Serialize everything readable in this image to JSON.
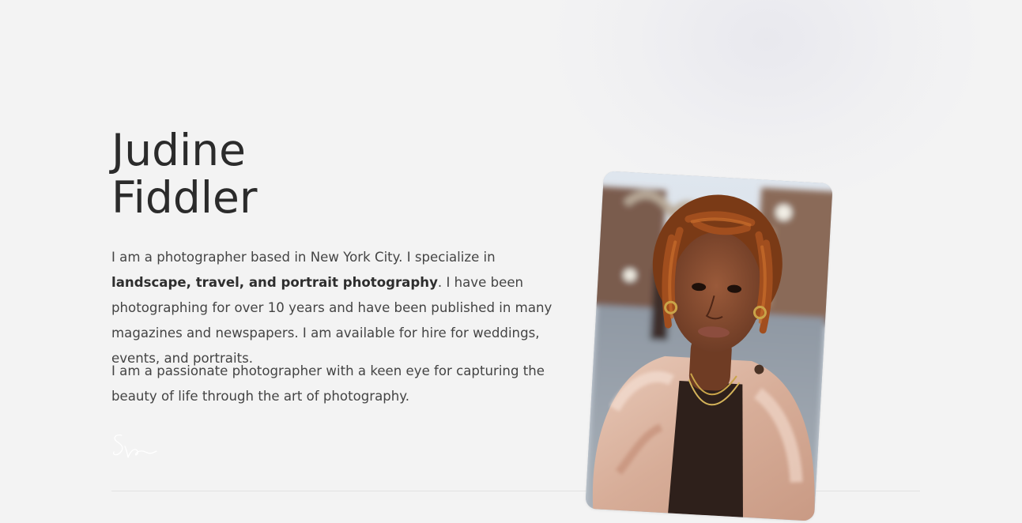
{
  "profile": {
    "first_name": "Judine",
    "last_name": "Fiddler",
    "bio_intro": "I am a photographer based in New York City. I specialize in ",
    "bio_specialties": "landscape, travel, and portrait photography",
    "bio_rest": ". I have been photographing for over 10 years and have been published in many magazines and newspapers. I am available for hire for weddings, events, and portraits.",
    "bio_second": "I am a passionate photographer with a keen eye for capturing the beauty of life through the art of photography.",
    "signature_icon": "signature-icon",
    "portrait_icon": "portrait-photo"
  }
}
